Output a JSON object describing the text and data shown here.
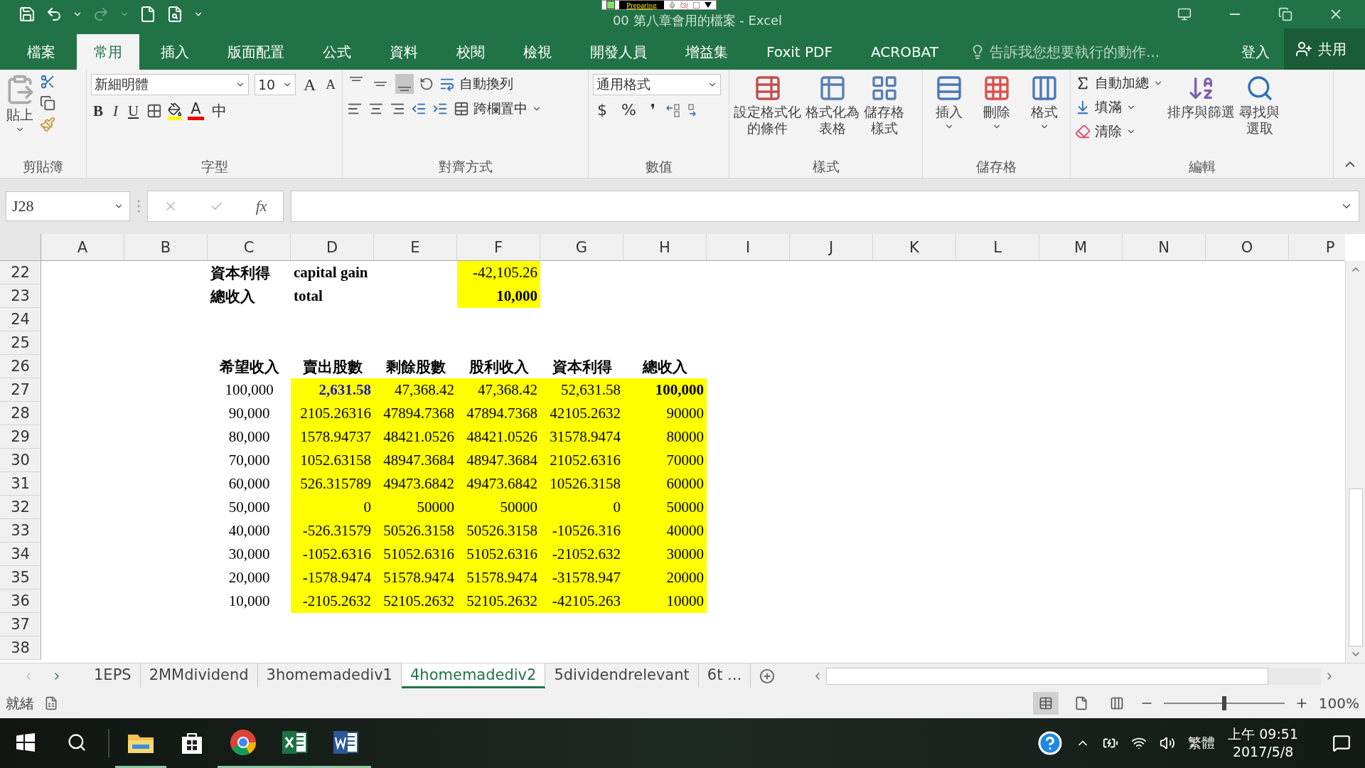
{
  "title_bar": {
    "title": "00 第八章會用的檔案 - Excel",
    "redo_disabled": true
  },
  "recorder": {
    "status": "Preparing"
  },
  "ribbon_tabs": [
    {
      "label": "檔案",
      "selected": false
    },
    {
      "label": "常用",
      "selected": true
    },
    {
      "label": "插入",
      "selected": false
    },
    {
      "label": "版面配置",
      "selected": false
    },
    {
      "label": "公式",
      "selected": false
    },
    {
      "label": "資料",
      "selected": false
    },
    {
      "label": "校閱",
      "selected": false
    },
    {
      "label": "檢視",
      "selected": false
    },
    {
      "label": "開發人員",
      "selected": false
    },
    {
      "label": "增益集",
      "selected": false
    },
    {
      "label": "Foxit PDF",
      "selected": false
    },
    {
      "label": "ACROBAT",
      "selected": false
    }
  ],
  "tell_me": {
    "placeholder": "告訴我您想要執行的動作..."
  },
  "sign_in": "登入",
  "share": "共用",
  "clipboard": {
    "label": "剪貼簿",
    "paste": "貼上"
  },
  "font": {
    "label": "字型",
    "name": "新細明體",
    "size": "10",
    "size_buttons": [
      "A",
      "A"
    ],
    "styles": [
      "B",
      "I",
      "U"
    ],
    "color_letter": "A",
    "phonetic": "中"
  },
  "alignment": {
    "label": "對齊方式",
    "vertical": [
      {
        "selected": false
      },
      {
        "selected": false
      },
      {
        "selected": true
      }
    ],
    "wrap": "自動換列",
    "merge": "跨欄置中"
  },
  "number": {
    "label": "數值",
    "format": "通用格式",
    "symbols": [
      "$",
      "%",
      "❜"
    ]
  },
  "styles": {
    "label": "樣式",
    "buttons": [
      {
        "kind": "conditional",
        "text": "設定格式化的條件"
      },
      {
        "kind": "table",
        "text": "格式化為表格"
      },
      {
        "kind": "cellstyle",
        "text": "儲存格樣式"
      }
    ]
  },
  "cells": {
    "label": "儲存格",
    "buttons": [
      {
        "kind": "insert",
        "text": "插入"
      },
      {
        "kind": "delete",
        "text": "刪除"
      },
      {
        "kind": "format",
        "text": "格式"
      }
    ]
  },
  "editing": {
    "label": "編輯",
    "small": [
      {
        "kind": "sum",
        "text": "自動加總"
      },
      {
        "kind": "fill",
        "text": "填滿"
      },
      {
        "kind": "clear",
        "text": "清除"
      }
    ],
    "buttons": [
      {
        "kind": "sort",
        "text": "排序與篩選"
      },
      {
        "kind": "find",
        "text": "尋找與選取"
      }
    ]
  },
  "formula_bar": {
    "name_box": "J28",
    "fx": "fx"
  },
  "columns": [
    "A",
    "B",
    "C",
    "D",
    "E",
    "F",
    "G",
    "H",
    "I",
    "J",
    "K",
    "L",
    "M",
    "N",
    "O",
    "P"
  ],
  "rows": [
    {
      "number": "22",
      "c": {
        "text": "資本利得",
        "kind": "label",
        "highlighted": false
      },
      "d": {
        "text": "capital gain",
        "kind": "label",
        "highlighted": false
      },
      "f": {
        "text": "-42,105.26",
        "kind": "number",
        "highlighted": true
      }
    },
    {
      "number": "23",
      "c": {
        "text": "總收入",
        "kind": "label",
        "highlighted": false
      },
      "d": {
        "text": "total",
        "kind": "label",
        "highlighted": false
      },
      "f": {
        "text": "10,000",
        "kind": "total",
        "highlighted": true
      }
    },
    {
      "number": "24"
    },
    {
      "number": "25"
    },
    {
      "number": "26",
      "c": {
        "text": "希望收入",
        "kind": "heading",
        "highlighted": false
      },
      "d": {
        "text": "賣出股數",
        "kind": "heading",
        "highlighted": false
      },
      "e": {
        "text": "剩餘股數",
        "kind": "heading",
        "highlighted": false
      },
      "f": {
        "text": "股利收入",
        "kind": "heading",
        "highlighted": false
      },
      "g": {
        "text": "資本利得",
        "kind": "heading",
        "highlighted": false
      },
      "h": {
        "text": "總收入",
        "kind": "heading",
        "highlighted": false
      }
    },
    {
      "number": "27",
      "c": {
        "text": "100,000",
        "kind": "input",
        "highlighted": false
      },
      "d": {
        "text": "2,631.58",
        "kind": "accent",
        "highlighted": true
      },
      "e": {
        "text": "47,368.42",
        "kind": "number",
        "highlighted": true
      },
      "f": {
        "text": "47,368.42",
        "kind": "number",
        "highlighted": true
      },
      "g": {
        "text": "52,631.58",
        "kind": "number",
        "highlighted": true
      },
      "h": {
        "text": "100,000",
        "kind": "total",
        "highlighted": true
      }
    },
    {
      "number": "28",
      "c": {
        "text": "90,000",
        "kind": "input",
        "highlighted": false
      },
      "d": {
        "text": "2105.26316",
        "kind": "number",
        "highlighted": true
      },
      "e": {
        "text": "47894.7368",
        "kind": "number",
        "highlighted": true
      },
      "f": {
        "text": "47894.7368",
        "kind": "number",
        "highlighted": true
      },
      "g": {
        "text": "42105.2632",
        "kind": "number",
        "highlighted": true
      },
      "h": {
        "text": "90000",
        "kind": "number",
        "highlighted": true
      }
    },
    {
      "number": "29",
      "c": {
        "text": "80,000",
        "kind": "input",
        "highlighted": false
      },
      "d": {
        "text": "1578.94737",
        "kind": "number",
        "highlighted": true
      },
      "e": {
        "text": "48421.0526",
        "kind": "number",
        "highlighted": true
      },
      "f": {
        "text": "48421.0526",
        "kind": "number",
        "highlighted": true
      },
      "g": {
        "text": "31578.9474",
        "kind": "number",
        "highlighted": true
      },
      "h": {
        "text": "80000",
        "kind": "number",
        "highlighted": true
      }
    },
    {
      "number": "30",
      "c": {
        "text": "70,000",
        "kind": "input",
        "highlighted": false
      },
      "d": {
        "text": "1052.63158",
        "kind": "number",
        "highlighted": true
      },
      "e": {
        "text": "48947.3684",
        "kind": "number",
        "highlighted": true
      },
      "f": {
        "text": "48947.3684",
        "kind": "number",
        "highlighted": true
      },
      "g": {
        "text": "21052.6316",
        "kind": "number",
        "highlighted": true
      },
      "h": {
        "text": "70000",
        "kind": "number",
        "highlighted": true
      }
    },
    {
      "number": "31",
      "c": {
        "text": "60,000",
        "kind": "input",
        "highlighted": false
      },
      "d": {
        "text": "526.315789",
        "kind": "number",
        "highlighted": true
      },
      "e": {
        "text": "49473.6842",
        "kind": "number",
        "highlighted": true
      },
      "f": {
        "text": "49473.6842",
        "kind": "number",
        "highlighted": true
      },
      "g": {
        "text": "10526.3158",
        "kind": "number",
        "highlighted": true
      },
      "h": {
        "text": "60000",
        "kind": "number",
        "highlighted": true
      }
    },
    {
      "number": "32",
      "c": {
        "text": "50,000",
        "kind": "input",
        "highlighted": false
      },
      "d": {
        "text": "0",
        "kind": "number",
        "highlighted": true
      },
      "e": {
        "text": "50000",
        "kind": "number",
        "highlighted": true
      },
      "f": {
        "text": "50000",
        "kind": "number",
        "highlighted": true
      },
      "g": {
        "text": "0",
        "kind": "number",
        "highlighted": true
      },
      "h": {
        "text": "50000",
        "kind": "number",
        "highlighted": true
      }
    },
    {
      "number": "33",
      "c": {
        "text": "40,000",
        "kind": "input",
        "highlighted": false
      },
      "d": {
        "text": "-526.31579",
        "kind": "number",
        "highlighted": true
      },
      "e": {
        "text": "50526.3158",
        "kind": "number",
        "highlighted": true
      },
      "f": {
        "text": "50526.3158",
        "kind": "number",
        "highlighted": true
      },
      "g": {
        "text": "-10526.316",
        "kind": "number",
        "highlighted": true
      },
      "h": {
        "text": "40000",
        "kind": "number",
        "highlighted": true
      }
    },
    {
      "number": "34",
      "c": {
        "text": "30,000",
        "kind": "input",
        "highlighted": false
      },
      "d": {
        "text": "-1052.6316",
        "kind": "number",
        "highlighted": true
      },
      "e": {
        "text": "51052.6316",
        "kind": "number",
        "highlighted": true
      },
      "f": {
        "text": "51052.6316",
        "kind": "number",
        "highlighted": true
      },
      "g": {
        "text": "-21052.632",
        "kind": "number",
        "highlighted": true
      },
      "h": {
        "text": "30000",
        "kind": "number",
        "highlighted": true
      }
    },
    {
      "number": "35",
      "c": {
        "text": "20,000",
        "kind": "input",
        "highlighted": false
      },
      "d": {
        "text": "-1578.9474",
        "kind": "number",
        "highlighted": true
      },
      "e": {
        "text": "51578.9474",
        "kind": "number",
        "highlighted": true
      },
      "f": {
        "text": "51578.9474",
        "kind": "number",
        "highlighted": true
      },
      "g": {
        "text": "-31578.947",
        "kind": "number",
        "highlighted": true
      },
      "h": {
        "text": "20000",
        "kind": "number",
        "highlighted": true
      }
    },
    {
      "number": "36",
      "c": {
        "text": "10,000",
        "kind": "input",
        "highlighted": false
      },
      "d": {
        "text": "-2105.2632",
        "kind": "number",
        "highlighted": true
      },
      "e": {
        "text": "52105.2632",
        "kind": "number",
        "highlighted": true
      },
      "f": {
        "text": "52105.2632",
        "kind": "number",
        "highlighted": true
      },
      "g": {
        "text": "-42105.263",
        "kind": "number",
        "highlighted": true
      },
      "h": {
        "text": "10000",
        "kind": "number",
        "highlighted": true
      }
    },
    {
      "number": "37"
    },
    {
      "number": "38"
    }
  ],
  "sheet_tabs": [
    {
      "label": "1EPS",
      "selected": false
    },
    {
      "label": "2MMdividend",
      "selected": false
    },
    {
      "label": "3homemadediv1",
      "selected": false
    },
    {
      "label": "4homemadediv2",
      "selected": true
    },
    {
      "label": "5dividendrelevant",
      "selected": false
    },
    {
      "label": "6t ...",
      "selected": false
    }
  ],
  "status_bar": {
    "status": "就緒",
    "zoom": "100%",
    "zoom_level": {
      "level": 0.5
    }
  },
  "taskbar": {
    "apps": [
      {
        "kind": "explorer",
        "running": true
      },
      {
        "kind": "store",
        "running": false
      },
      {
        "kind": "chrome",
        "running": true
      },
      {
        "kind": "excel",
        "running": true
      },
      {
        "kind": "word",
        "running": true
      }
    ],
    "ime": "繁體",
    "time": "上午 09:51",
    "date": "2017/5/8"
  }
}
